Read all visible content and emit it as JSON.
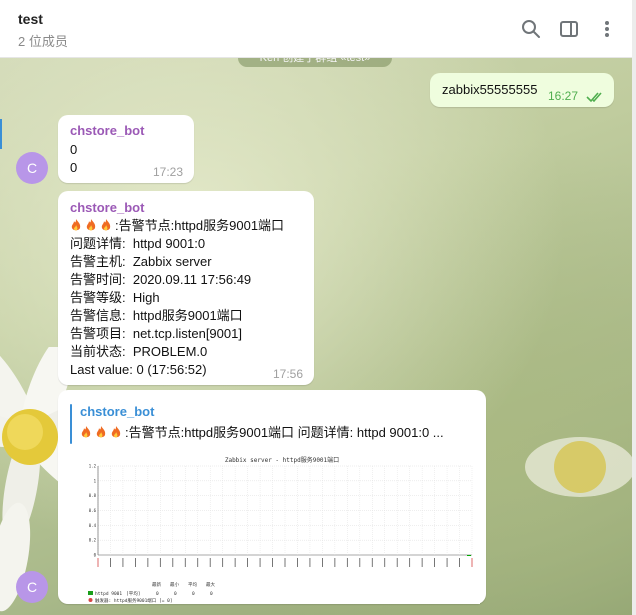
{
  "header": {
    "title": "test",
    "subtitle": "2 位成员",
    "icons": [
      "search-icon",
      "sidebar-toggle-icon",
      "more-icon"
    ]
  },
  "service_message": "Ken 创建了群组 «test»",
  "messages": {
    "outgoing": {
      "text": "zabbix55555555",
      "time": "16:27",
      "status": "read"
    },
    "m1": {
      "sender": "chstore_bot",
      "line1": "0",
      "line2": "0",
      "time": "17:23"
    },
    "m2": {
      "sender": "chstore_bot",
      "lines": [
        ":告警节点:httpd服务9001端口",
        "问题详情:  httpd 9001:0",
        "告警主机:  Zabbix server",
        "告警时间:  2020.09.11 17:56:49",
        "告警等级:  High",
        "告警信息:  httpd服务9001端口",
        "告警项目:  net.tcp.listen[9001]",
        "当前状态:  PROBLEM.0",
        "Last value: 0 (17:56:52)"
      ],
      "time": "17:56"
    },
    "m3": {
      "sender": "chstore_bot",
      "preview_text": ":告警节点:httpd服务9001端口  问题详情:  httpd 9001:0 ...",
      "graph_title": "Zabbix server - httpd服务9001端口"
    }
  },
  "avatar_letter": "C",
  "colors": {
    "sender_purple": "#9b59b6",
    "link_blue": "#3a8fd6",
    "outgoing_bg": "#effdde",
    "check_green": "#4fae4e",
    "avatar_bg": "#b896e8"
  },
  "chart_data": {
    "type": "line",
    "title": "Zabbix server - httpd服务9001端口",
    "series": [
      {
        "name": "httpd 9001",
        "values": [
          0
        ]
      }
    ],
    "ylim": [
      0,
      1.2
    ],
    "yticks": [
      "1.2",
      "1",
      "0.8",
      "0.6",
      "0.4",
      "0.2",
      "0"
    ],
    "legend": {
      "columns": [
        "最新",
        "最小",
        "平均",
        "最大"
      ],
      "rows": [
        {
          "name": "httpd 9001",
          "func": "[平均]",
          "values": [
            "0",
            "0",
            "0",
            "0"
          ]
        }
      ],
      "trigger": "触发器: httpd服务9001端口    [= 0]"
    }
  }
}
